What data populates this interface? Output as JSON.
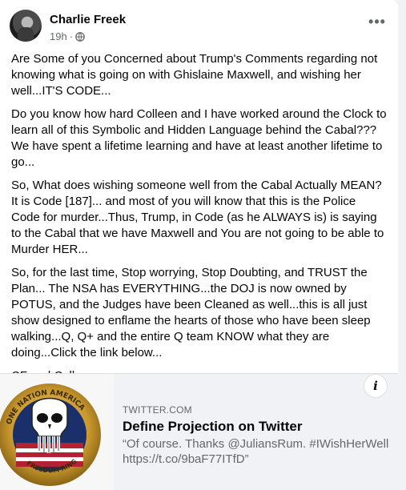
{
  "post": {
    "author": "Charlie Freek",
    "time": "19h",
    "separator": "·",
    "more_label": "•••",
    "paragraphs": [
      "Are Some of you Concerned about Trump's Comments regarding not knowing what is going on with Ghislaine Maxwell, and wishing her well...IT'S CODE...",
      "Do you know how hard Colleen and I have worked around the Clock to learn all of this Symbolic and Hidden Language behind the Cabal??? We have spent a lifetime learning and have at least another lifetime to go...",
      "So, What does wishing someone well from the Cabal Actually MEAN? It is Code [187]... and most of you will know that this is the Police Code for murder...Thus, Trump, in Code (as he ALWAYS is) is saying to the Cabal that we have Maxwell and You are not going to be able to Murder HER...",
      "So, for the last time, Stop worrying, Stop Doubting, and TRUST the Plan... The NSA has EVERYTHING...the DOJ is now owned by POTUS, and the Judges have been Cleaned as well...this is all just show designed to enflame the hearts of those who have been sleep walking...Q, Q+ and the entire Q team KNOW what they are doing...Click the link below...",
      "CF and Coll"
    ]
  },
  "link_preview": {
    "domain": "TWITTER.COM",
    "title": "Define Projection on Twitter",
    "description_line1": "“Of course. Thanks @JuliansRum. #IWishHerWell",
    "description_line2": "https://t.co/9baF77ITfD”",
    "info_label": "i",
    "thumb_text_top": "ONE NATION  AMERICA",
    "thumb_text_bottom": "FREEDOM RING"
  },
  "colors": {
    "accent_text": "#050505",
    "secondary_text": "#65676b",
    "preview_bg": "#f0f2f5"
  }
}
